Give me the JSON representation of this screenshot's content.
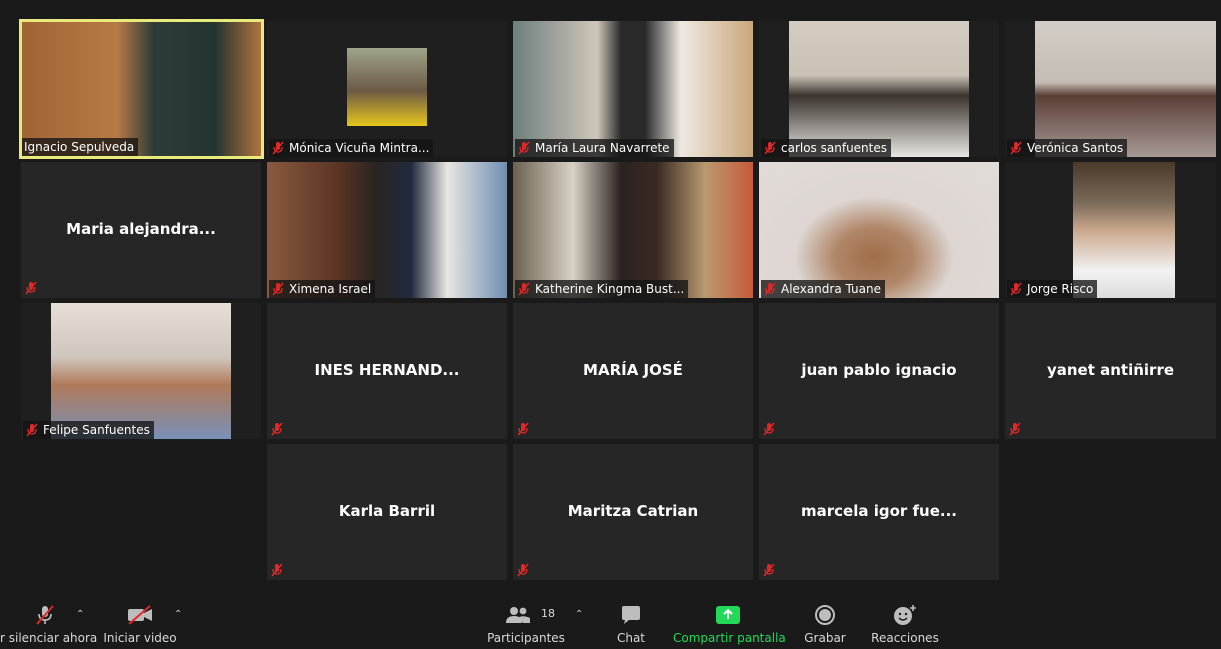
{
  "participants": {
    "t1": {
      "name": "Ignacio Sepulveda",
      "bg": "#a86a3c"
    },
    "t2": {
      "name": "Mónica Vicuña Mintra...",
      "bg": "#8a8f6e"
    },
    "t3": {
      "name": "María Laura Navarrete",
      "bg": "#c9c1b6"
    },
    "t4": {
      "name": "carlos sanfuentes",
      "bg": "#d8d2c8"
    },
    "t5": {
      "name": "Verónica Santos",
      "bg": "#c7c2bc"
    },
    "t6": {
      "display": "Maria  alejandra..."
    },
    "t7": {
      "name": "Ximena Israel",
      "bg": "#7a5a48"
    },
    "t8": {
      "name": "Katherine Kingma Bust...",
      "bg": "#b8a890"
    },
    "t9": {
      "name": "Alexandra Tuane",
      "bg": "#ddd6d2"
    },
    "t10": {
      "name": "Jorge Risco",
      "bg": "#6b6a64"
    },
    "t11": {
      "name": "Felipe Sanfuentes",
      "bg": "#cfc6bd"
    },
    "t12": {
      "display": "INES  HERNAND..."
    },
    "t13": {
      "display": "MARÍA JOSÉ"
    },
    "t14": {
      "display": "juan pablo ignacio"
    },
    "t15": {
      "display": "yanet antiñirre"
    },
    "t16": {
      "display": "Karla Barril"
    },
    "t17": {
      "display": "Maritza Catrian"
    },
    "t18": {
      "display": "marcela  igor  fue..."
    }
  },
  "toolbar": {
    "mute_label": "r silenciar ahora",
    "video_label": "Iniciar video",
    "participants_label": "Participantes",
    "participants_count": "18",
    "chat_label": "Chat",
    "share_label": "Compartir pantalla",
    "record_label": "Grabar",
    "reactions_label": "Reacciones"
  },
  "colors": {
    "muted_red": "#e02828",
    "share_green": "#23d959",
    "active_speaker": "#e9ea7c"
  }
}
